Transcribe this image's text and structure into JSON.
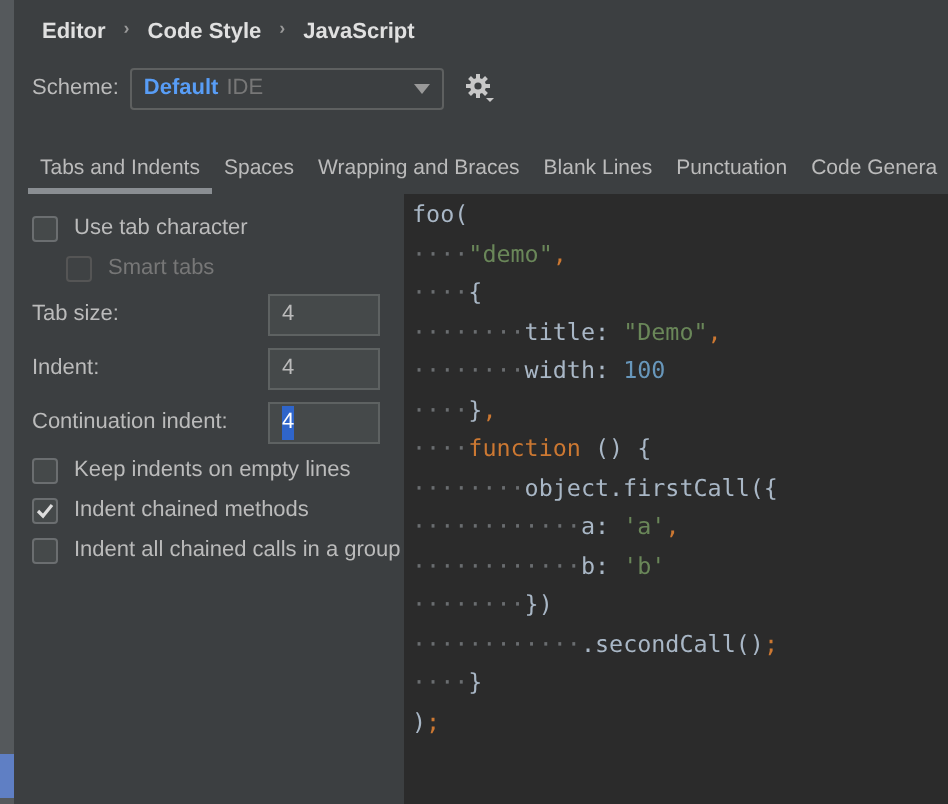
{
  "breadcrumb": [
    {
      "kind": "link",
      "text": "Editor"
    },
    {
      "kind": "separator",
      "text": "›"
    },
    {
      "kind": "link",
      "text": "Code Style"
    },
    {
      "kind": "separator",
      "text": "›"
    },
    {
      "kind": "link",
      "text": "JavaScript"
    }
  ],
  "scheme": {
    "label": "Scheme:",
    "value": "Default",
    "qualifier": "IDE"
  },
  "tabs": [
    {
      "label": "Tabs and Indents",
      "selected": true
    },
    {
      "label": "Spaces",
      "selected": false
    },
    {
      "label": "Wrapping and Braces",
      "selected": false
    },
    {
      "label": "Blank Lines",
      "selected": false
    },
    {
      "label": "Punctuation",
      "selected": false
    },
    {
      "label": "Code Genera",
      "selected": false
    }
  ],
  "options": [
    {
      "kind": "checkbox",
      "label": "Use tab character",
      "checked": false,
      "disabled": false,
      "nested": false
    },
    {
      "kind": "checkbox",
      "label": "Smart tabs",
      "checked": false,
      "disabled": true,
      "nested": true
    },
    {
      "kind": "field",
      "label": "Tab size:",
      "value": "4",
      "selected": false
    },
    {
      "kind": "field",
      "label": "Indent:",
      "value": "4",
      "selected": false
    },
    {
      "kind": "field",
      "label": "Continuation indent:",
      "value": "4",
      "selected": true
    },
    {
      "kind": "checkbox",
      "label": "Keep indents on empty lines",
      "checked": false,
      "disabled": false,
      "nested": false
    },
    {
      "kind": "checkbox",
      "label": "Indent chained methods",
      "checked": true,
      "disabled": false,
      "nested": false
    },
    {
      "kind": "checkbox",
      "label": "Indent all chained calls in a group",
      "checked": false,
      "disabled": false,
      "nested": false
    }
  ],
  "code_lines": [
    [
      {
        "kind": "plain",
        "text": "foo("
      }
    ],
    [
      {
        "kind": "space",
        "text": "····"
      },
      {
        "kind": "string",
        "text": "\"demo\""
      },
      {
        "kind": "punct",
        "text": ","
      }
    ],
    [
      {
        "kind": "space",
        "text": "····"
      },
      {
        "kind": "plain",
        "text": "{"
      }
    ],
    [
      {
        "kind": "space",
        "text": "········"
      },
      {
        "kind": "plain",
        "text": "title: "
      },
      {
        "kind": "string",
        "text": "\"Demo\""
      },
      {
        "kind": "punct",
        "text": ","
      }
    ],
    [
      {
        "kind": "space",
        "text": "········"
      },
      {
        "kind": "plain",
        "text": "width: "
      },
      {
        "kind": "number",
        "text": "100"
      }
    ],
    [
      {
        "kind": "space",
        "text": "····"
      },
      {
        "kind": "plain",
        "text": "}"
      },
      {
        "kind": "punct",
        "text": ","
      }
    ],
    [
      {
        "kind": "space",
        "text": "····"
      },
      {
        "kind": "keyword",
        "text": "function"
      },
      {
        "kind": "plain",
        "text": " () {"
      }
    ],
    [
      {
        "kind": "space",
        "text": "········"
      },
      {
        "kind": "plain",
        "text": "object.firstCall({"
      }
    ],
    [
      {
        "kind": "space",
        "text": "············"
      },
      {
        "kind": "plain",
        "text": "a: "
      },
      {
        "kind": "string",
        "text": "'a'"
      },
      {
        "kind": "punct",
        "text": ","
      }
    ],
    [
      {
        "kind": "space",
        "text": "············"
      },
      {
        "kind": "plain",
        "text": "b: "
      },
      {
        "kind": "string",
        "text": "'b'"
      }
    ],
    [
      {
        "kind": "space",
        "text": "········"
      },
      {
        "kind": "plain",
        "text": "})"
      }
    ],
    [
      {
        "kind": "space",
        "text": "············"
      },
      {
        "kind": "plain",
        "text": ".secondCall()"
      },
      {
        "kind": "punct",
        "text": ";"
      }
    ],
    [
      {
        "kind": "space",
        "text": "····"
      },
      {
        "kind": "plain",
        "text": "}"
      }
    ],
    [
      {
        "kind": "plain",
        "text": ")"
      },
      {
        "kind": "punct",
        "text": ";"
      }
    ]
  ]
}
